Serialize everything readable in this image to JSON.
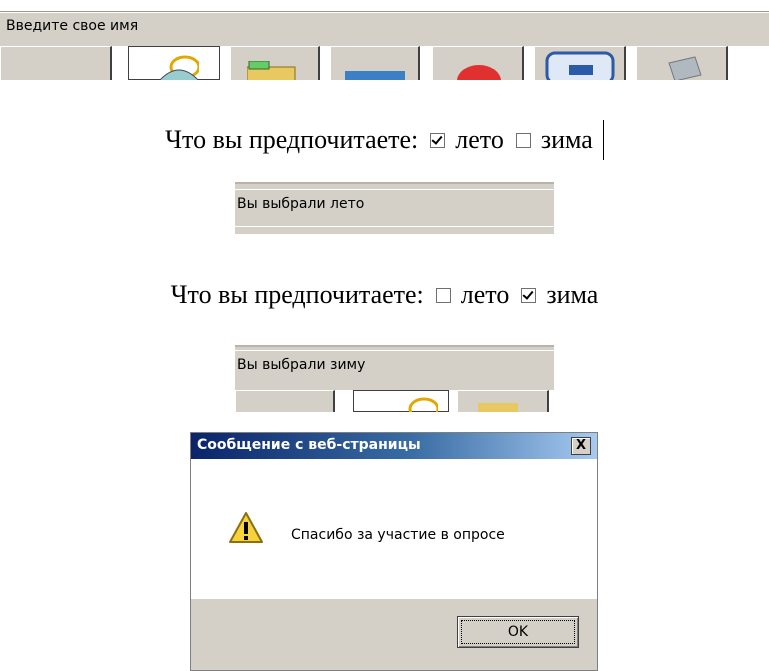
{
  "top_bar": {
    "label": "Введите свое имя"
  },
  "question1": {
    "prompt": "Что вы предпочитаете:",
    "option_summer": "лето",
    "option_winter": "зима",
    "summer_checked": true,
    "winter_checked": false
  },
  "result1": {
    "text": "Вы выбрали лето"
  },
  "question2": {
    "prompt": "Что вы предпочитаете:",
    "option_summer": "лето",
    "option_winter": "зима",
    "summer_checked": false,
    "winter_checked": true
  },
  "result2": {
    "text": "Вы выбрали зиму"
  },
  "dialog": {
    "title": "Сообщение с веб-страницы",
    "close_glyph": "X",
    "message": "Спасибо за участие в опросе",
    "ok_label": "OK",
    "icon": "warning-icon"
  },
  "colors": {
    "panel": "#d4d0c8",
    "title_bar_start": "#0a246a",
    "title_bar_end": "#a6caf0"
  }
}
